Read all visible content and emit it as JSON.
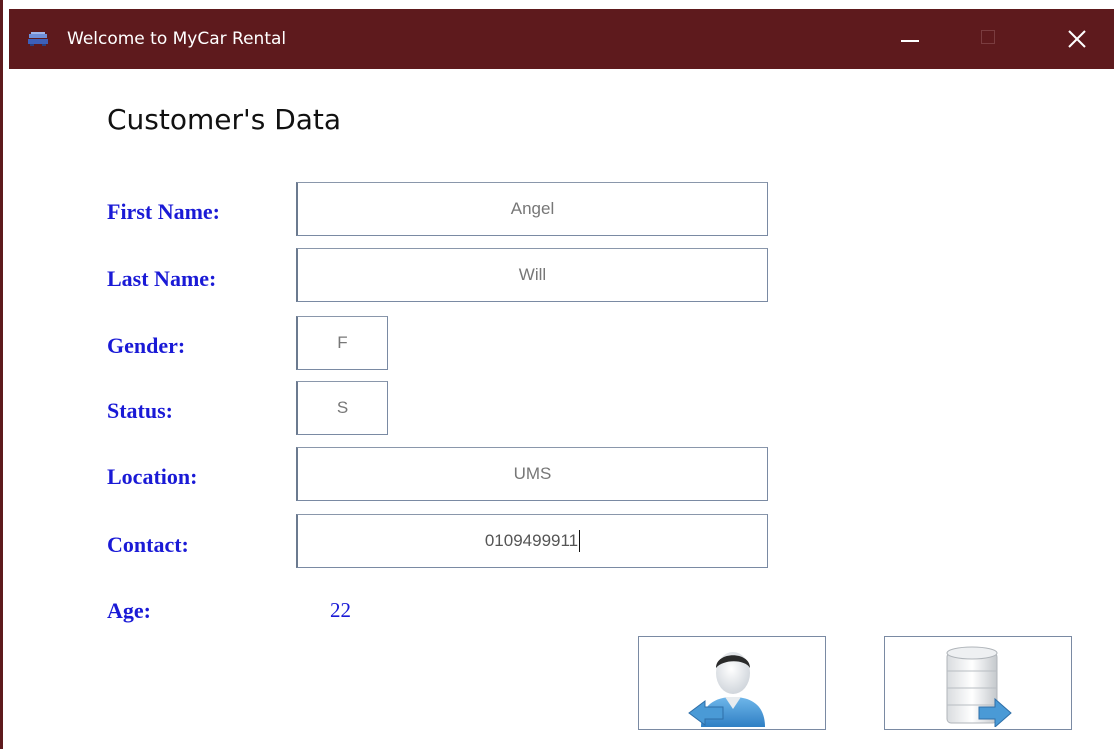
{
  "window": {
    "title": "Welcome to MyCar Rental",
    "icon": "car-icon",
    "controls": [
      "minimize-icon",
      "maximize-icon",
      "close-icon"
    ]
  },
  "form": {
    "heading": "Customer's Data",
    "labels": {
      "first_name": "First Name:",
      "last_name": "Last Name:",
      "gender": "Gender:",
      "status": "Status:",
      "location": "Location:",
      "contact": "Contact:",
      "age": "Age:"
    },
    "values": {
      "first_name": "Angel",
      "last_name": "Will",
      "gender": "F",
      "status": "S",
      "location": "UMS",
      "contact": "0109499911",
      "age": "22"
    }
  },
  "buttons": [
    {
      "icon": "user-back-icon"
    },
    {
      "icon": "database-forward-icon"
    }
  ],
  "colors": {
    "titlebar": "#5e1a1d",
    "label": "#1a1ad6",
    "field_text": "#777777"
  }
}
